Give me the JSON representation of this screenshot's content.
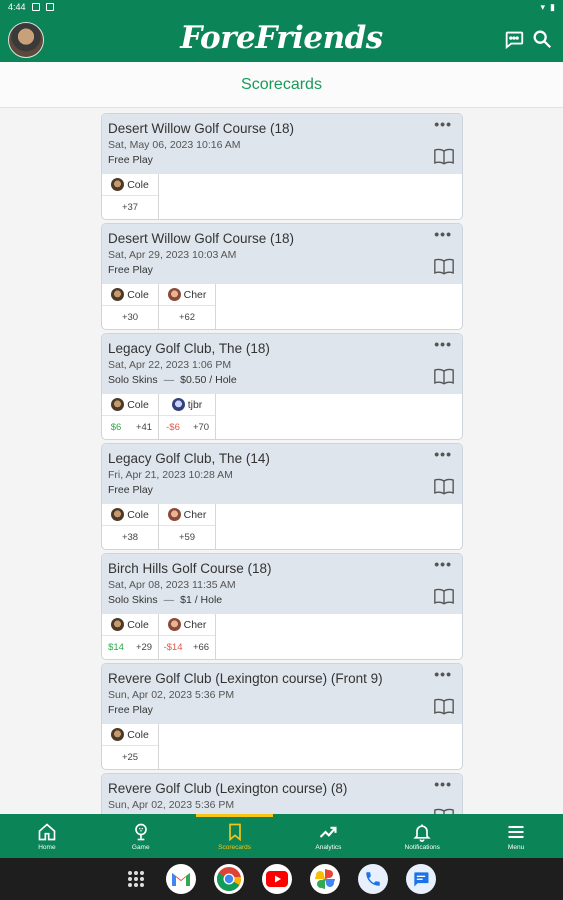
{
  "status_bar": {
    "time": "4:44"
  },
  "header": {
    "logo": "ForeFriends"
  },
  "subheader": {
    "title": "Scorecards"
  },
  "cards": [
    {
      "title": "Desert Willow Golf Course (18)",
      "date": "Sat, May 06, 2023 10:16 AM",
      "game": "Free Play",
      "game_detail": "",
      "players": [
        {
          "name": "Cole",
          "avatar": "cole",
          "scores": [
            "+37"
          ]
        }
      ]
    },
    {
      "title": "Desert Willow Golf Course (18)",
      "date": "Sat, Apr 29, 2023 10:03 AM",
      "game": "Free Play",
      "game_detail": "",
      "players": [
        {
          "name": "Cole",
          "avatar": "cole",
          "scores": [
            "+30"
          ]
        },
        {
          "name": "Cher",
          "avatar": "cher",
          "scores": [
            "+62"
          ]
        }
      ]
    },
    {
      "title": "Legacy Golf Club, The (18)",
      "date": "Sat, Apr 22, 2023 1:06 PM",
      "game": "Solo Skins",
      "game_detail": "$0.50 / Hole",
      "players": [
        {
          "name": "Cole",
          "avatar": "cole",
          "scores": [
            "$6",
            "+41"
          ]
        },
        {
          "name": "tjbr",
          "avatar": "tjbr",
          "scores": [
            "-$6",
            "+70"
          ]
        }
      ]
    },
    {
      "title": "Legacy Golf Club, The (14)",
      "date": "Fri, Apr 21, 2023 10:28 AM",
      "game": "Free Play",
      "game_detail": "",
      "players": [
        {
          "name": "Cole",
          "avatar": "cole",
          "scores": [
            "+38"
          ]
        },
        {
          "name": "Cher",
          "avatar": "cher",
          "scores": [
            "+59"
          ]
        }
      ]
    },
    {
      "title": "Birch Hills Golf Course (18)",
      "date": "Sat, Apr 08, 2023 11:35 AM",
      "game": "Solo Skins",
      "game_detail": "$1 / Hole",
      "players": [
        {
          "name": "Cole",
          "avatar": "cole",
          "scores": [
            "$14",
            "+29"
          ]
        },
        {
          "name": "Cher",
          "avatar": "cher",
          "scores": [
            "-$14",
            "+66"
          ]
        }
      ]
    },
    {
      "title": "Revere Golf Club (Lexington course) (Front 9)",
      "date": "Sun, Apr 02, 2023 5:36 PM",
      "game": "Free Play",
      "game_detail": "",
      "players": [
        {
          "name": "Cole",
          "avatar": "cole",
          "scores": [
            "+25"
          ]
        }
      ]
    },
    {
      "title": "Revere Golf Club (Lexington course) (8)",
      "date": "Sun, Apr 02, 2023 5:36 PM",
      "game": "",
      "game_detail": "",
      "players": []
    }
  ],
  "card_menu_label": "•••",
  "nav": [
    {
      "label": "Home",
      "icon": "home-icon"
    },
    {
      "label": "Game",
      "icon": "golf-ball-icon"
    },
    {
      "label": "Scorecards",
      "icon": "bookmark-icon",
      "active": true
    },
    {
      "label": "Analytics",
      "icon": "trending-up-icon"
    },
    {
      "label": "Notifications",
      "icon": "bell-icon"
    },
    {
      "label": "Menu",
      "icon": "menu-icon"
    }
  ],
  "dock_apps": [
    "gmail-icon",
    "chrome-icon",
    "youtube-icon",
    "photos-icon",
    "phone-icon",
    "messages-icon"
  ],
  "colors": {
    "brand": "#0b8457",
    "accent": "#f5c518",
    "positive": "#2aa84a",
    "negative": "#e05a4a"
  }
}
